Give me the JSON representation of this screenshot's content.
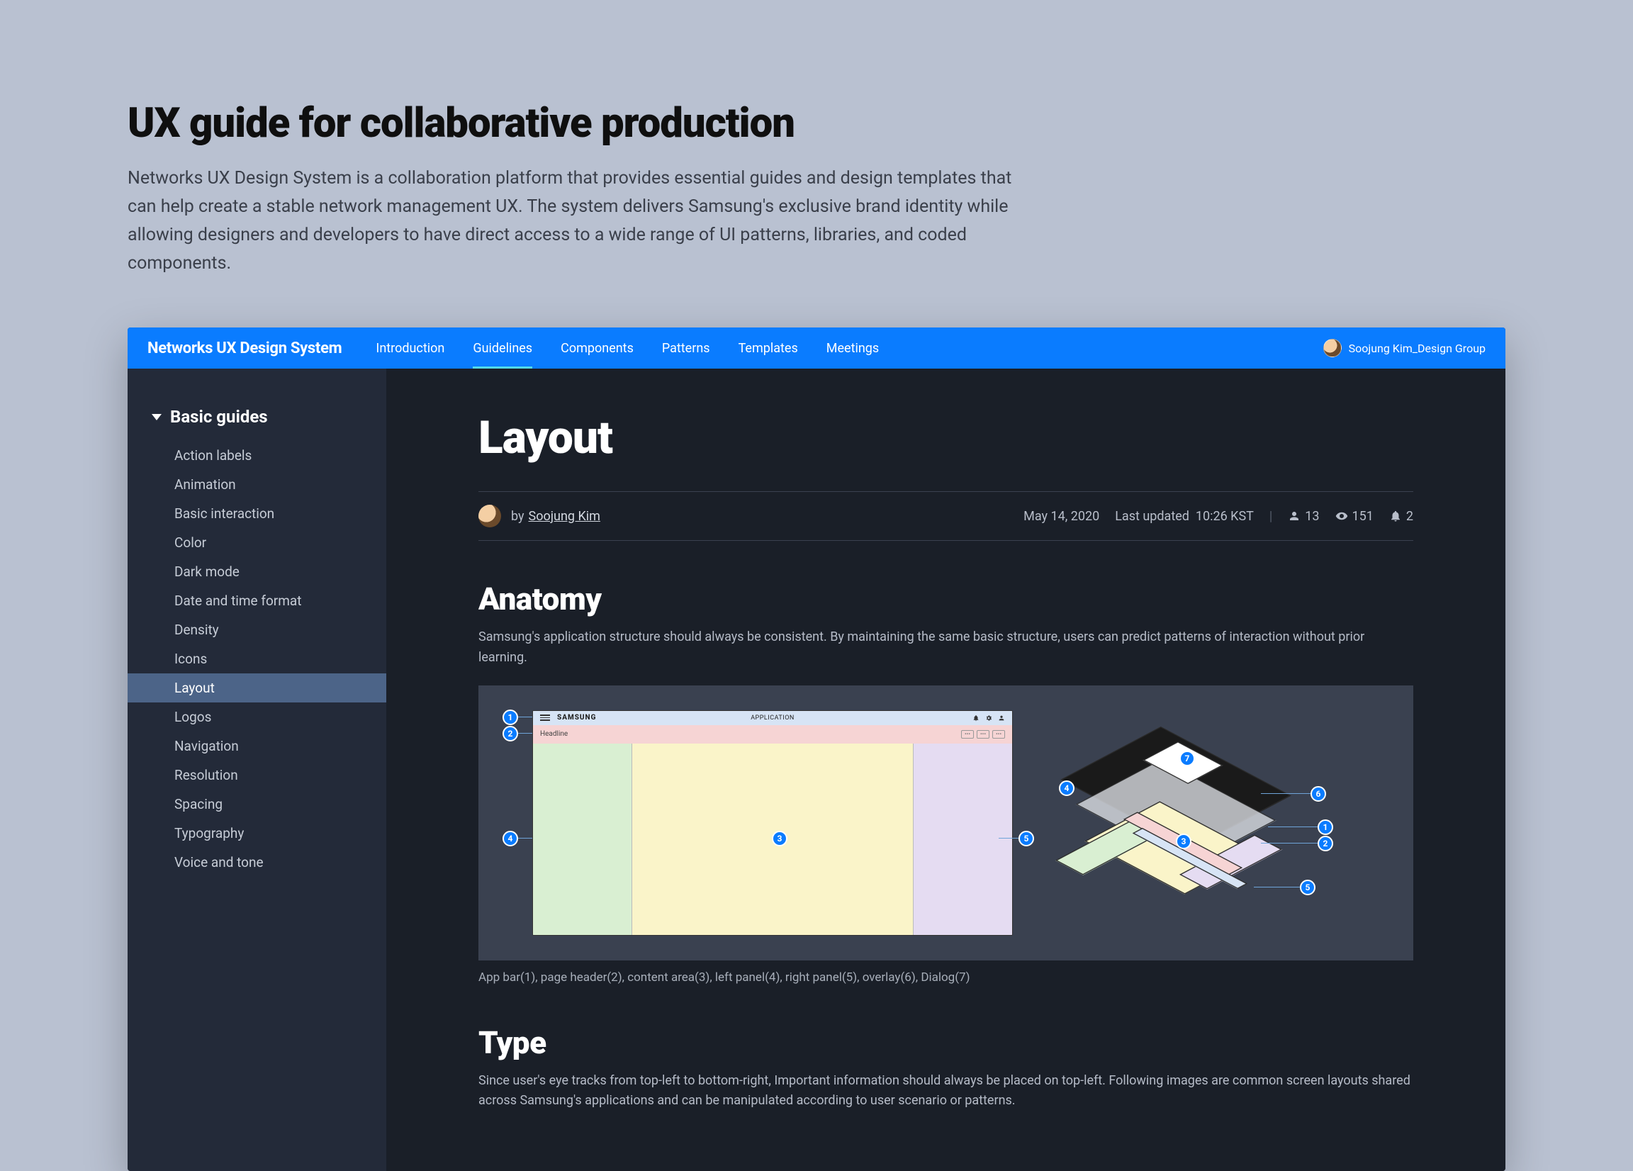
{
  "hero": {
    "title": "UX guide for collaborative production",
    "description": "Networks UX Design System is a collaboration platform that provides essential guides and design templates that can help create a stable network management UX. The system delivers Samsung's exclusive brand identity while allowing designers and developers to have direct access to a wide range of UI patterns, libraries, and coded components."
  },
  "topbar": {
    "brand": "Networks UX Design System",
    "nav": [
      {
        "label": "Introduction"
      },
      {
        "label": "Guidelines",
        "active": true
      },
      {
        "label": "Components"
      },
      {
        "label": "Patterns"
      },
      {
        "label": "Templates"
      },
      {
        "label": "Meetings"
      }
    ],
    "user": "Soojung Kim_Design Group"
  },
  "sidebar": {
    "section": "Basic guides",
    "items": [
      "Action labels",
      "Animation",
      "Basic interaction",
      "Color",
      "Dark mode",
      "Date and time format",
      "Density",
      "Icons",
      "Layout",
      "Logos",
      "Navigation",
      "Resolution",
      "Spacing",
      "Typography",
      "Voice and tone"
    ],
    "activeIndex": 8
  },
  "page": {
    "title": "Layout",
    "meta": {
      "by": "by",
      "author": "Soojung Kim",
      "date": "May 14, 2020",
      "updated_label": "Last updated",
      "updated_time": "10:26 KST",
      "contributors": "13",
      "views": "151",
      "comments": "2"
    },
    "anatomy": {
      "heading": "Anatomy",
      "body": "Samsung's application structure should always be consistent. By maintaining the same basic structure, users can predict patterns of interaction without prior learning.",
      "mock": {
        "brand": "SAMSUNG",
        "app_title": "APPLICATION",
        "headline": "Headline"
      },
      "badges_left": [
        "1",
        "2",
        "3",
        "4",
        "5"
      ],
      "badges_right": [
        "1",
        "2",
        "3",
        "4",
        "5",
        "6"
      ],
      "caption": "App bar(1), page header(2), content area(3), left panel(4), right panel(5), overlay(6), Dialog(7)"
    },
    "type": {
      "heading": "Type",
      "body": "Since user's eye tracks from top-left to bottom-right, Important information should always be placed on top-left. Following images are common screen layouts shared across Samsung's applications and can be manipulated according to user scenario or patterns."
    }
  }
}
